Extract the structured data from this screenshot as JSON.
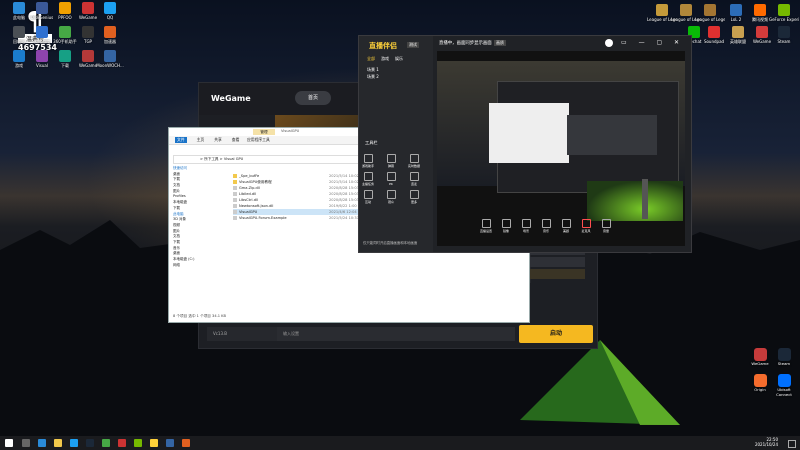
{
  "streamer": {
    "name": "温典号",
    "channel_number": "4697534"
  },
  "desktop_icons_left": [
    {
      "label": "此电脑",
      "color": "#2a8bd8"
    },
    {
      "label": "DiskGenius",
      "color": "#3b5998"
    },
    {
      "label": "PPFOO",
      "color": "#f0a000"
    },
    {
      "label": "WeGame",
      "color": "#cc3333"
    },
    {
      "label": "QQ",
      "color": "#1ca0f2"
    },
    {
      "label": "回收站",
      "color": "#4a4f55"
    },
    {
      "label": "腾讯游戏",
      "color": "#2f70d0"
    },
    {
      "label": "360手机助手",
      "color": "#46a845"
    },
    {
      "label": "TGP",
      "color": "#333333"
    },
    {
      "label": "加速器",
      "color": "#e06020"
    },
    {
      "label": "游戏",
      "color": "#1b7ccc"
    },
    {
      "label": "Visual",
      "color": "#8e44ad"
    },
    {
      "label": "下载",
      "color": "#16a085"
    },
    {
      "label": "WeGame",
      "color": "#b33939"
    },
    {
      "label": "MoonWOCH...",
      "color": "#3465a4"
    }
  ],
  "desktop_icons_top_right": [
    {
      "label": "League of Legends",
      "color": "#c49a3a"
    },
    {
      "label": "League of Legends",
      "color": "#b0873a"
    },
    {
      "label": "League of Legends",
      "color": "#a37532"
    },
    {
      "label": "LoL 2",
      "color": "#2c6db8"
    },
    {
      "label": "腾讯视频",
      "color": "#ff6a00"
    },
    {
      "label": "GeForce Experience",
      "color": "#76b900"
    },
    {
      "label": "Wechat",
      "color": "#09bb07"
    },
    {
      "label": "Soundpad",
      "color": "#e03030"
    },
    {
      "label": "英雄联盟",
      "color": "#c8a050"
    },
    {
      "label": "WeGame",
      "color": "#d33b3b"
    },
    {
      "label": "Steam",
      "color": "#1b2838"
    },
    {
      "label": "Origin",
      "color": "#f56c2d"
    }
  ],
  "desktop_icons_bottom_right": [
    {
      "label": "WeGame",
      "color": "#c63b3b"
    },
    {
      "label": "Steam",
      "color": "#1b2838"
    },
    {
      "label": "Origin",
      "color": "#f56c2d"
    },
    {
      "label": "Ubisoft Connect",
      "color": "#0070ff"
    }
  ],
  "wegame": {
    "logo": "WeGame",
    "tab_home": "首页",
    "start_button": "启动",
    "search_placeholder": "输入设置",
    "version": "Vc13.B"
  },
  "explorer": {
    "title": "VisualGPU",
    "tabs": [
      "文件",
      "主页",
      "共享",
      "查看"
    ],
    "context_tab": "应用程序工具",
    "context_header": "管理",
    "path": "> 所下工具 > Visual GPU",
    "search_placeholder": "搜索\"Visual GPU\"",
    "nav_items": [
      "快速访问",
      "桌面",
      "下载",
      "文档",
      "图片",
      "Profiles",
      "本地磁盘",
      "下载",
      "此电脑",
      "3D 对象",
      "视频",
      "图片",
      "文档",
      "下载",
      "音乐",
      "桌面",
      "本地磁盘 (C:)",
      "网络"
    ],
    "files": [
      {
        "name": "_Spe_bufFe",
        "date": "2021/5/14 10:02"
      },
      {
        "name": "VisualGPU使用教程",
        "date": "2021/5/14 10:02"
      },
      {
        "name": "Gma.Zip.dll",
        "date": "2020/8/28 15:03"
      },
      {
        "name": "Libiled.dll",
        "date": "2020/8/28 15:03"
      },
      {
        "name": "LibsCtrl.dll",
        "date": "2020/8/28 15:03"
      },
      {
        "name": "Newtonsoft.Json.dll",
        "date": "2019/6/22 1:00"
      },
      {
        "name": "VisualGPU",
        "date": "2021/4/6 12:04"
      },
      {
        "name": "VisualGPU.Forum.Example",
        "date": "2021/5/24 10:37"
      }
    ],
    "status": "8 个项目  选中 1 个项目 34.1 KB"
  },
  "streaming_tool": {
    "title": "直播伴侣",
    "badge": "测试",
    "tabs": [
      "全部",
      "游戏",
      "娱乐"
    ],
    "scene_items": [
      "场景 1",
      "场景 2"
    ],
    "tools_header": "工具栏",
    "tool_items": [
      "游戏助手",
      "弹幕",
      "实时数据",
      "主播任务",
      "PK",
      "连麦",
      "互动",
      "观众",
      "更多"
    ],
    "preview_title": "直播中，画面同步显示画面",
    "preview_tag": "画质",
    "controls": [
      "直播设置",
      "镜像",
      "场景",
      "音乐",
      "美颜",
      "麦克风",
      "音量"
    ],
    "footer_notice": "仅只能同时开启直播画面和本地画面"
  },
  "taskbar": {
    "time": "22:50",
    "date": "2021/10/24"
  }
}
